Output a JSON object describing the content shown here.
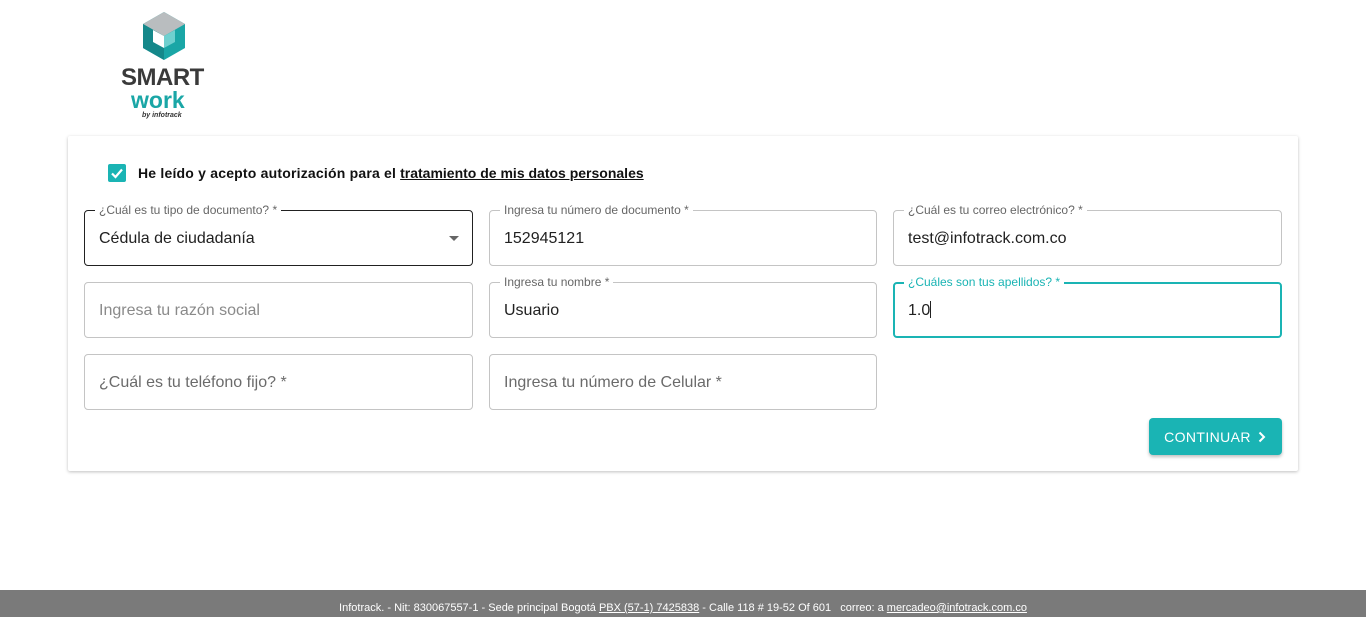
{
  "logo": {
    "line1": "SMART",
    "line2": "work",
    "line3": "by infotrack"
  },
  "consent": {
    "checked": true,
    "text": "He leído y acepto autorización para el",
    "link": "tratamiento de mis datos personales"
  },
  "form": {
    "doc_type": {
      "label": "¿Cuál es tu tipo de documento? *",
      "value": "Cédula de ciudadanía"
    },
    "doc_number": {
      "label": "Ingresa tu número de documento *",
      "value": "152945121"
    },
    "email": {
      "label": "¿Cuál es tu correo electrónico? *",
      "value": "test@infotrack.com.co"
    },
    "business_name": {
      "placeholder": "Ingresa tu razón social"
    },
    "name": {
      "label": "Ingresa tu nombre *",
      "value": "Usuario"
    },
    "surnames": {
      "label": "¿Cuáles son tus apellidos? *",
      "value": "1.0"
    },
    "phone": {
      "placeholder": "¿Cuál es tu teléfono fijo? *"
    },
    "mobile": {
      "placeholder": "Ingresa tu número de Celular *"
    }
  },
  "continue_button": {
    "label": "CONTINUAR"
  },
  "footer": {
    "part1": "Infotrack. - Nit: 830067557-1 - Sede principal Bogotá",
    "pbx": "PBX (57-1) 7425838",
    "part2": "- Calle 118 # 19-52 Of 601",
    "mail_prefix": "correo: a",
    "email": "mercadeo@infotrack.com.co"
  },
  "colors": {
    "accent": "#1ab4b4",
    "footer_bg": "#7a7a7a",
    "logo_teal": "#1aa6a6"
  },
  "icons": {
    "check": "check-icon",
    "dropdown": "dropdown-arrow-icon",
    "chevron": "chevron-right-icon"
  }
}
